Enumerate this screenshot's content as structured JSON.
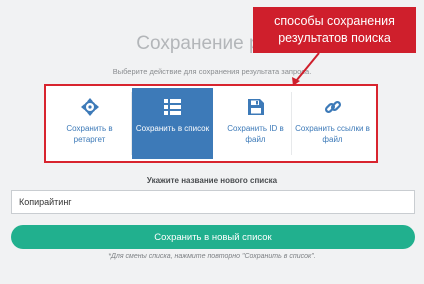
{
  "page": {
    "title": "Сохранение резу",
    "subtitle": "Выберите действие для сохранения результата запроса."
  },
  "callout": {
    "line1": "способы сохранения",
    "line2": "результатов поиска"
  },
  "options": [
    {
      "label": "Сохранить в ретаргет",
      "icon": "crosshair-icon",
      "active": false
    },
    {
      "label": "Сохранить в список",
      "icon": "list-table-icon",
      "active": true
    },
    {
      "label": "Сохранить ID в файл",
      "icon": "floppy-disk-icon",
      "active": false
    },
    {
      "label": "Сохранить ссылки в файл",
      "icon": "link-icon",
      "active": false
    }
  ],
  "new_list": {
    "heading": "Укажите название нового списка",
    "input_value": "Копирайтинг",
    "save_label": "Сохранить в новый список",
    "footnote": "*Для смены списка, нажмите повторно \"Сохранить в список\"."
  },
  "colors": {
    "accent": "#3d7ab8",
    "button": "#21b08e",
    "callout": "#cf1f2c",
    "frame": "#d8242e"
  }
}
